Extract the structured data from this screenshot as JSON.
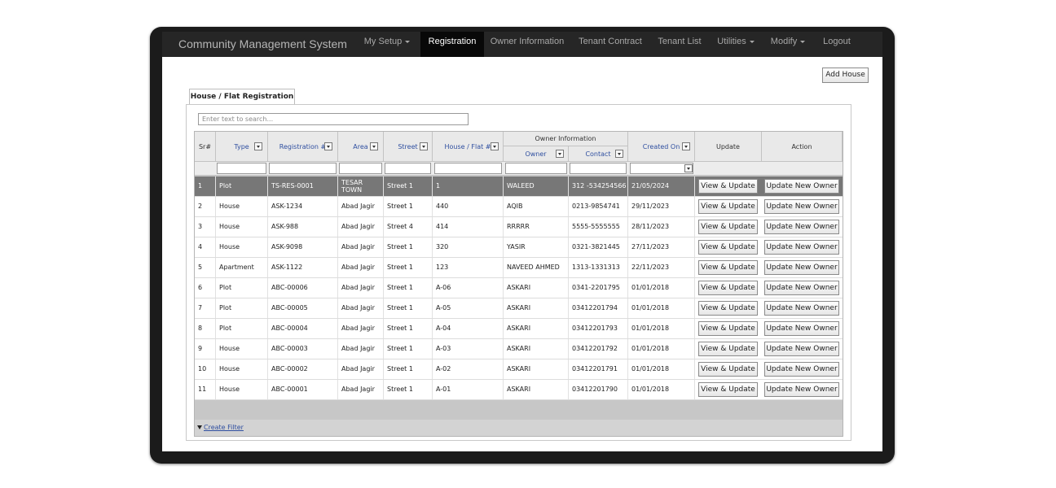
{
  "navbar": {
    "brand": "Community Management System",
    "items": [
      {
        "label": "My Setup",
        "dropdown": true
      },
      {
        "label": "Registration",
        "active": true
      },
      {
        "label": "Owner Information"
      },
      {
        "label": "Tenant Contract"
      },
      {
        "label": "Tenant List"
      },
      {
        "label": "Utilities",
        "dropdown": true
      },
      {
        "label": "Modify",
        "dropdown": true
      },
      {
        "label": "Logout"
      }
    ]
  },
  "toolbar": {
    "add_house_label": "Add House"
  },
  "tab": {
    "label": "House / Flat Registration"
  },
  "search": {
    "placeholder": "Enter text to search..."
  },
  "grid": {
    "headers": {
      "sr": "Sr#",
      "type": "Type",
      "registration": "Registration #",
      "area": "Area",
      "street": "Street",
      "house": "House / Flat #",
      "owner_group": "Owner Information",
      "owner": "Owner",
      "contact": "Contact",
      "created": "Created On",
      "update": "Update",
      "action": "Action"
    },
    "update_button_label": "View & Update",
    "action_button_label": "Update New Owner",
    "rows": [
      {
        "sr": "1",
        "type": "Plot",
        "reg": "TS-RES-0001",
        "area": "TESAR TOWN",
        "street": "Street 1",
        "house": "1",
        "owner": "WALEED",
        "contact": "312 -534254566",
        "created": "21/05/2024",
        "selected": true
      },
      {
        "sr": "2",
        "type": "House",
        "reg": "ASK-1234",
        "area": "Abad Jagir",
        "street": "Street 1",
        "house": "440",
        "owner": "AQIB",
        "contact": "0213-9854741",
        "created": "29/11/2023"
      },
      {
        "sr": "3",
        "type": "House",
        "reg": "ASK-988",
        "area": "Abad Jagir",
        "street": "Street 4",
        "house": "414",
        "owner": "RRRRR",
        "contact": "5555-5555555",
        "created": "28/11/2023"
      },
      {
        "sr": "4",
        "type": "House",
        "reg": "ASK-9098",
        "area": "Abad Jagir",
        "street": "Street 1",
        "house": "320",
        "owner": "YASIR",
        "contact": "0321-3821445",
        "created": "27/11/2023"
      },
      {
        "sr": "5",
        "type": "Apartment",
        "reg": "ASK-1122",
        "area": "Abad Jagir",
        "street": "Street 1",
        "house": "123",
        "owner": "NAVEED AHMED",
        "contact": "1313-1331313",
        "created": "22/11/2023"
      },
      {
        "sr": "6",
        "type": "Plot",
        "reg": "ABC-00006",
        "area": "Abad Jagir",
        "street": "Street 1",
        "house": "A-06",
        "owner": "ASKARI",
        "contact": "0341-2201795",
        "created": "01/01/2018"
      },
      {
        "sr": "7",
        "type": "Plot",
        "reg": "ABC-00005",
        "area": "Abad Jagir",
        "street": "Street 1",
        "house": "A-05",
        "owner": "ASKARI",
        "contact": "03412201794",
        "created": "01/01/2018"
      },
      {
        "sr": "8",
        "type": "Plot",
        "reg": "ABC-00004",
        "area": "Abad Jagir",
        "street": "Street 1",
        "house": "A-04",
        "owner": "ASKARI",
        "contact": "03412201793",
        "created": "01/01/2018"
      },
      {
        "sr": "9",
        "type": "House",
        "reg": "ABC-00003",
        "area": "Abad Jagir",
        "street": "Street 1",
        "house": "A-03",
        "owner": "ASKARI",
        "contact": "03412201792",
        "created": "01/01/2018"
      },
      {
        "sr": "10",
        "type": "House",
        "reg": "ABC-00002",
        "area": "Abad Jagir",
        "street": "Street 1",
        "house": "A-02",
        "owner": "ASKARI",
        "contact": "03412201791",
        "created": "01/01/2018"
      },
      {
        "sr": "11",
        "type": "House",
        "reg": "ABC-00001",
        "area": "Abad Jagir",
        "street": "Street 1",
        "house": "A-01",
        "owner": "ASKARI",
        "contact": "03412201790",
        "created": "01/01/2018"
      }
    ],
    "footer": {
      "create_filter_label": "Create Filter"
    }
  },
  "icons": {
    "filter": "funnel-icon",
    "column_filter": "dropdown-arrow-icon",
    "caret": "caret-down-icon"
  }
}
